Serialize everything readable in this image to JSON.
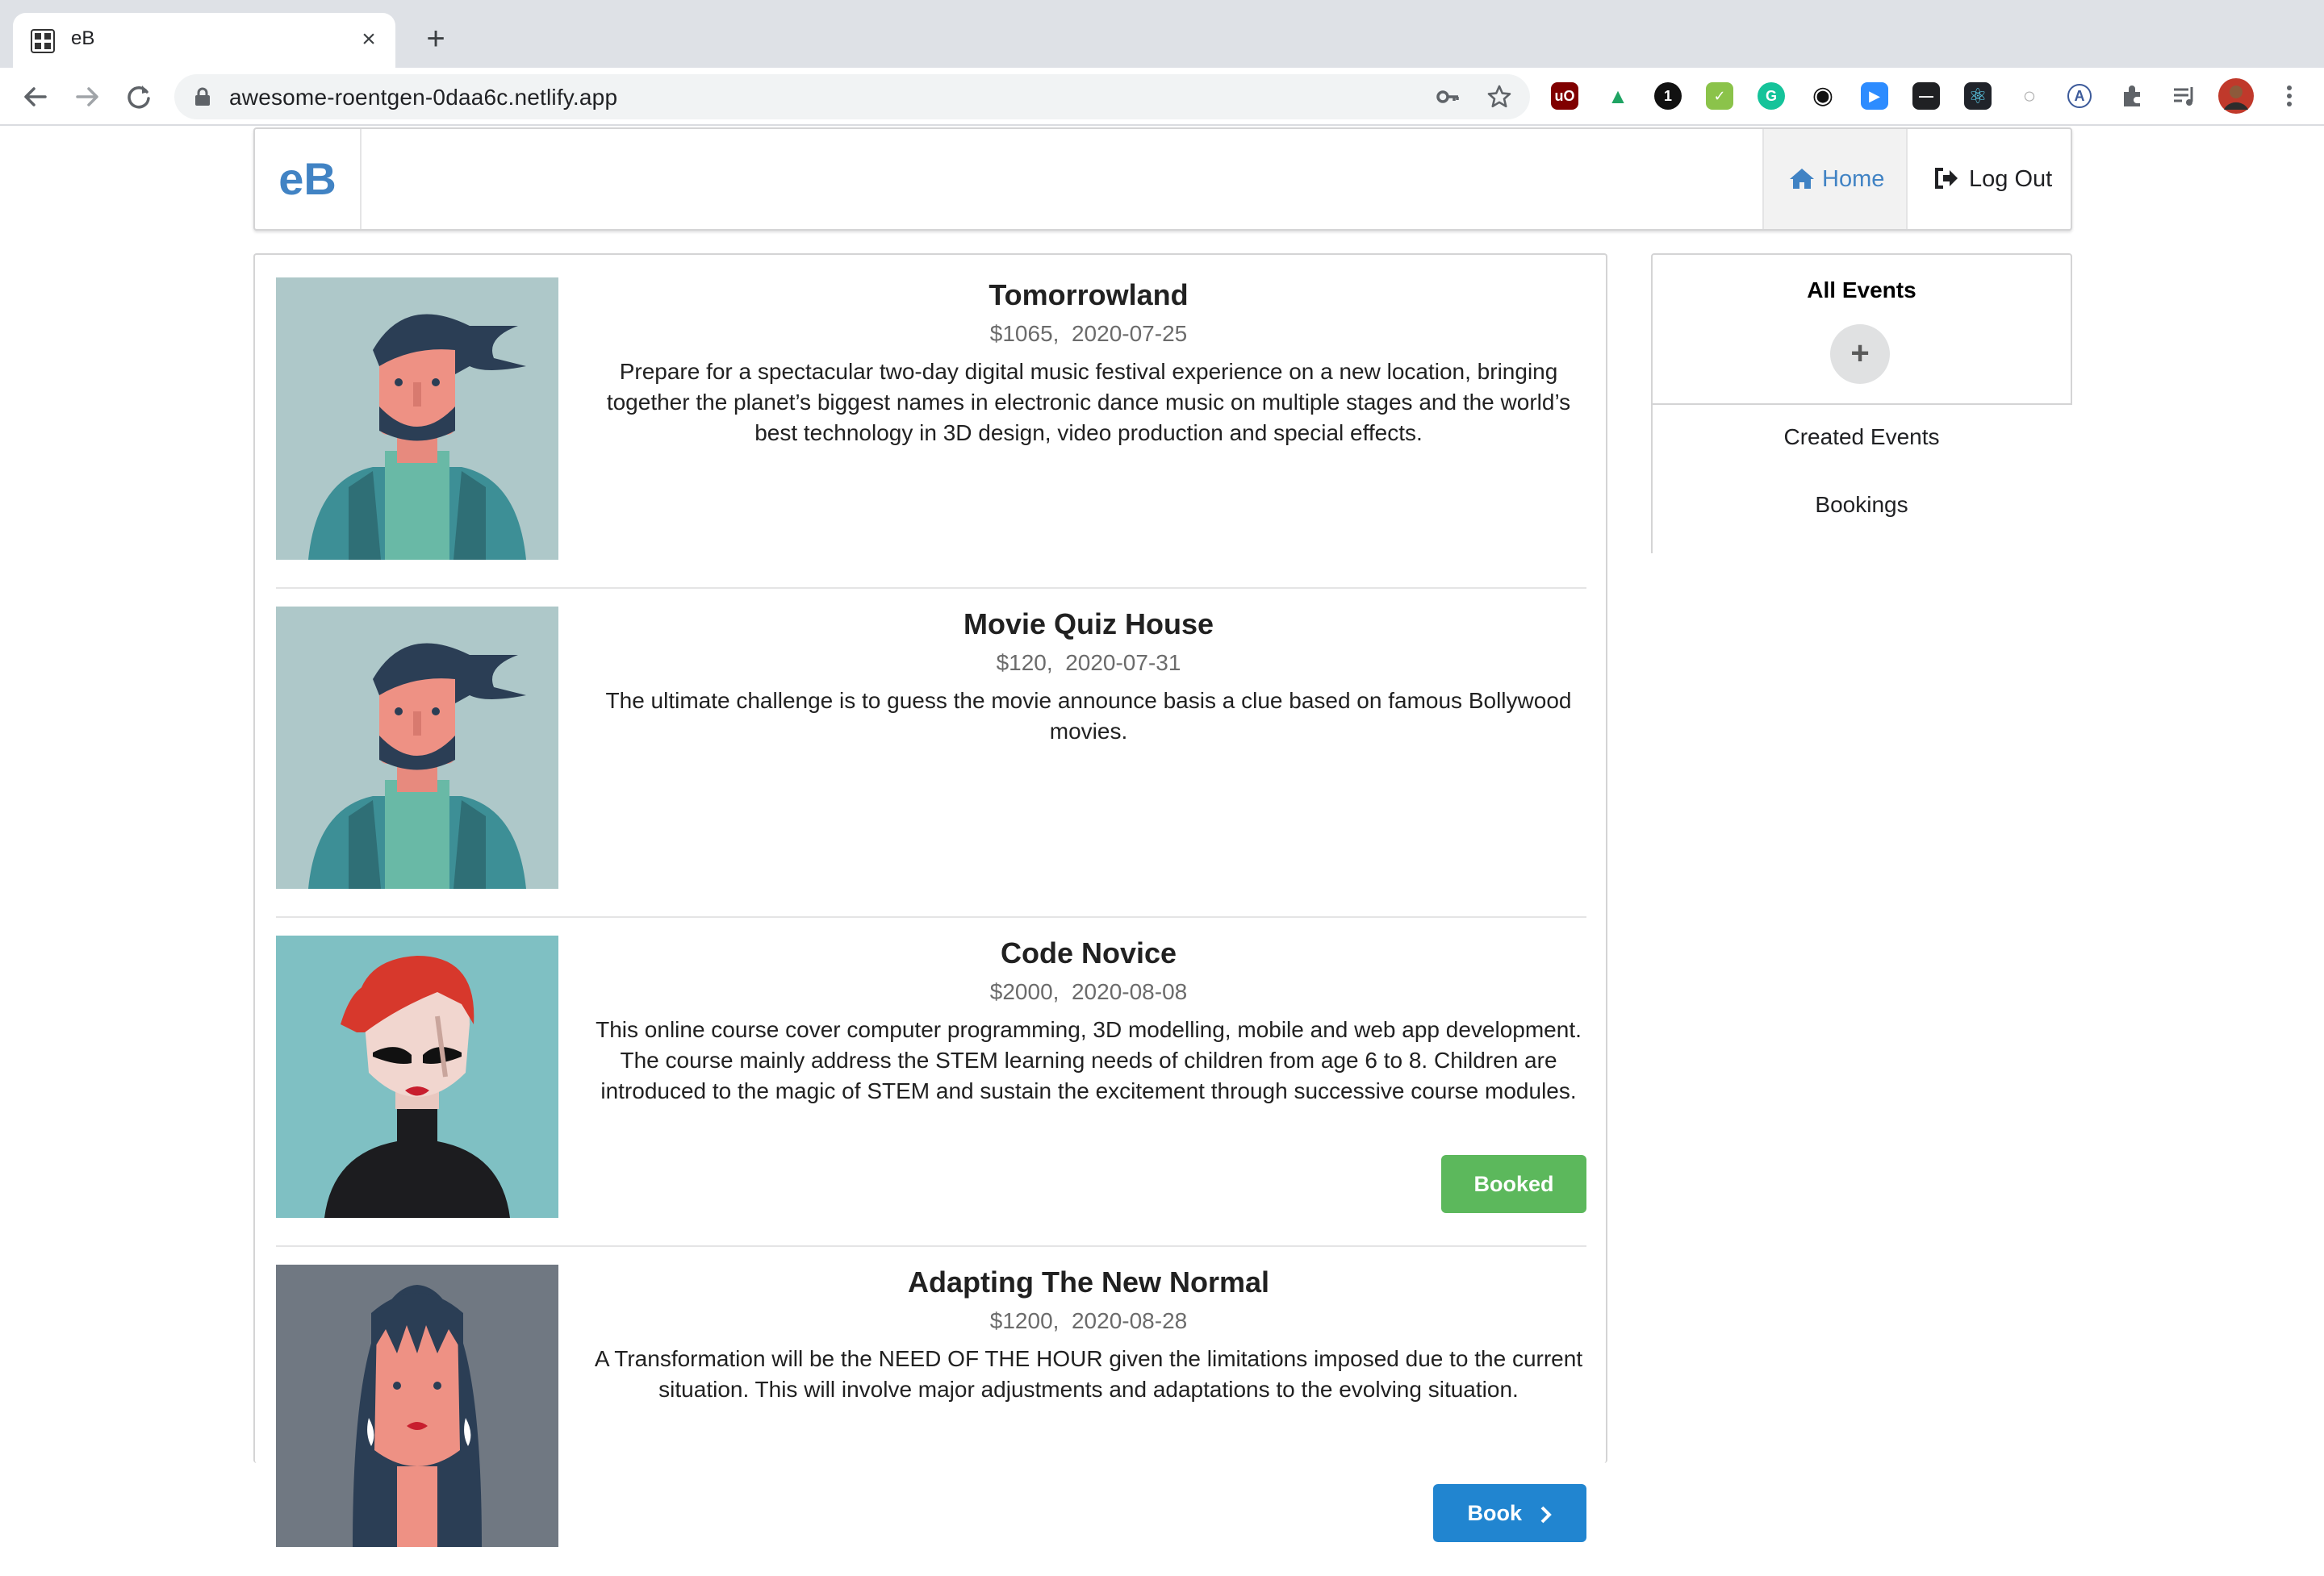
{
  "browser": {
    "tab_title": "eB",
    "tab_close": "×",
    "new_tab": "+",
    "url": "awesome-roentgen-0daa6c.netlify.app",
    "icons": [
      "back-arrow-icon",
      "forward-arrow-icon",
      "reload-icon",
      "lock-icon",
      "key-icon",
      "star-icon",
      "extensions-icon",
      "menu-icon"
    ],
    "extensions": [
      {
        "name": "ublock-icon",
        "color": "#800000",
        "glyph": "uO"
      },
      {
        "name": "drive-icon",
        "color": "#1fa463",
        "glyph": "▲"
      },
      {
        "name": "onepassword-icon",
        "color": "#111111",
        "glyph": "1"
      },
      {
        "name": "checker-icon",
        "color": "#8bc34a",
        "glyph": "✓"
      },
      {
        "name": "grammarly-icon",
        "color": "#15c39a",
        "glyph": "G"
      },
      {
        "name": "record-icon",
        "color": "#111111",
        "glyph": "◉"
      },
      {
        "name": "zoom-icon",
        "color": "#2d8cff",
        "glyph": "▶"
      },
      {
        "name": "minus-box-icon",
        "color": "#202124",
        "glyph": "—"
      },
      {
        "name": "react-devtools-icon",
        "color": "#20232a",
        "glyph": "⚛"
      },
      {
        "name": "circle-ext-icon",
        "color": "#e8eaed",
        "glyph": "○"
      },
      {
        "name": "font-ext-icon",
        "color": "#ffffff",
        "glyph": "A"
      }
    ]
  },
  "navbar": {
    "brand": "eB",
    "home": "Home",
    "logout": "Log Out"
  },
  "events": [
    {
      "title": "Tomorrowland",
      "meta": "$1065,  2020-07-25",
      "description": "Prepare for a spectacular two-day digital music festival experience on a new location, bringing together the planet’s biggest names in electronic dance music on multiple stages and the world’s best technology in 3D design, video production and special effects.",
      "avatar": "bearded-man-avatar",
      "action": ""
    },
    {
      "title": "Movie Quiz House",
      "meta": "$120,  2020-07-31",
      "description": "The ultimate challenge is to guess the movie announce basis a clue based on famous Bollywood movies.",
      "avatar": "bearded-man-avatar",
      "action": ""
    },
    {
      "title": "Code Novice",
      "meta": "$2000,  2020-08-08",
      "description": "This online course cover computer programming, 3D modelling, mobile and web app development. The course mainly address the STEM learning needs of children from age 6 to 8. Children are introduced to the magic of STEM and sustain the excitement through successive course modules.",
      "avatar": "red-hair-woman-avatar",
      "action": "Booked"
    },
    {
      "title": "Adapting The New Normal",
      "meta": "$1200,  2020-08-28",
      "description": "A Transformation will be the NEED OF THE HOUR given the limitations imposed due to the current situation. This will involve major adjustments and adaptations to the evolving situation.",
      "avatar": "long-hair-woman-avatar",
      "action": "Book"
    }
  ],
  "sidebar": {
    "active": "All Events",
    "add": "+",
    "items": [
      "Created Events",
      "Bookings"
    ]
  }
}
